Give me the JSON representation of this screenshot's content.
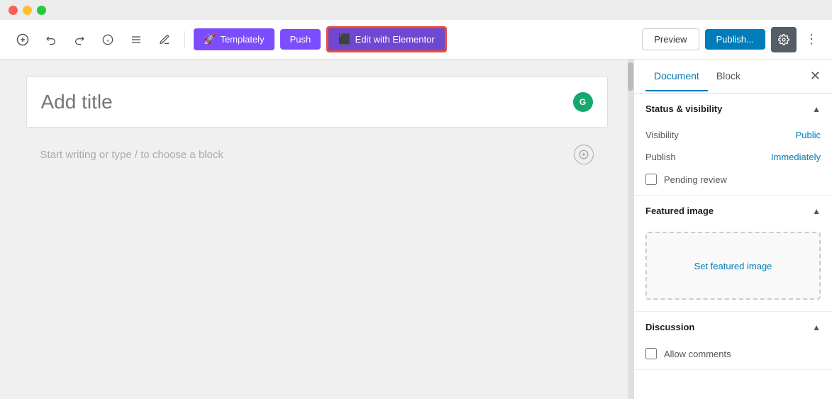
{
  "titleBar": {
    "lights": [
      "red",
      "yellow",
      "green"
    ]
  },
  "toolbar": {
    "addLabel": "+",
    "undoLabel": "↩",
    "redoLabel": "↪",
    "infoLabel": "ℹ",
    "listLabel": "≡",
    "pencilLabel": "✏",
    "templatlyLabel": "Templately",
    "pushLabel": "Push",
    "elementorLabel": "Edit with Elementor",
    "previewLabel": "Preview",
    "publishLabel": "Publish...",
    "settingsLabel": "⚙",
    "moreLabel": "⋮"
  },
  "editor": {
    "titlePlaceholder": "Add title",
    "contentPlaceholder": "Start writing or type / to choose a block"
  },
  "sidebar": {
    "tabs": [
      {
        "label": "Document",
        "active": true
      },
      {
        "label": "Block",
        "active": false
      }
    ],
    "closeLabel": "✕",
    "sections": {
      "statusVisibility": {
        "title": "Status & visibility",
        "visibility": {
          "label": "Visibility",
          "value": "Public"
        },
        "publish": {
          "label": "Publish",
          "value": "Immediately"
        },
        "pendingReview": {
          "label": "Pending review",
          "checked": false
        }
      },
      "featuredImage": {
        "title": "Featured image",
        "setImageLabel": "Set featured image"
      },
      "discussion": {
        "title": "Discussion",
        "allowComments": {
          "label": "Allow comments",
          "checked": false
        }
      }
    }
  }
}
